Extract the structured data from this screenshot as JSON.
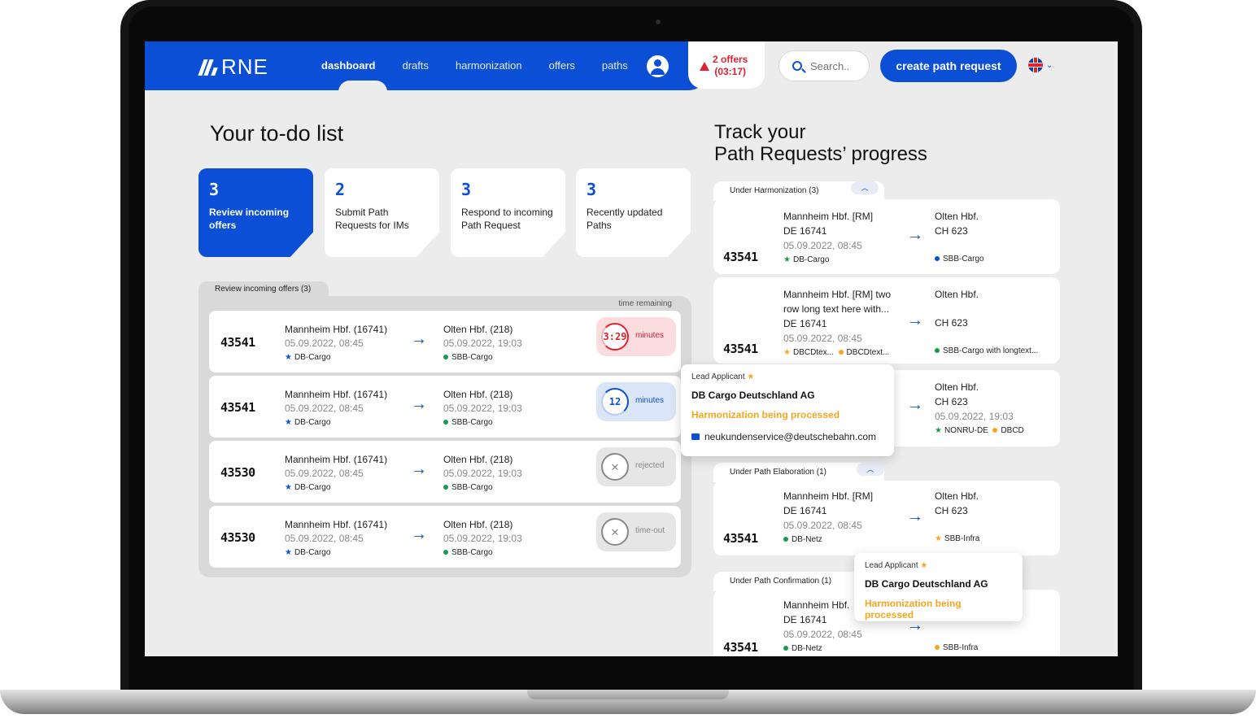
{
  "nav": {
    "logo": "RNE",
    "links": [
      "dashboard",
      "drafts",
      "harmonization",
      "offers",
      "paths"
    ],
    "offers_alert": [
      "2 offers",
      "(03:17)"
    ],
    "search_placeholder": "Search..",
    "create_button": "create path request"
  },
  "todo": {
    "title": "Your to-do list",
    "cards": [
      {
        "count": "3",
        "label": "Review incoming offers"
      },
      {
        "count": "2",
        "label": "Submit Path Requests for IMs"
      },
      {
        "count": "3",
        "label": "Respond to incoming Path Request"
      },
      {
        "count": "3",
        "label": "Recently updated Paths"
      }
    ]
  },
  "offers": {
    "tab_label": "Review incoming offers (3)",
    "time_remaining_label": "time remaining",
    "rows": [
      {
        "id": "43541",
        "from": "Mannheim Hbf. (16741)",
        "from_time": "05.09.2022, 08:45",
        "from_op": "DB-Cargo",
        "to": "Olten Hbf. (218)",
        "to_time": "05.09.2022, 19:03",
        "to_op": "SBB-Cargo",
        "status_value": "3:29",
        "status_label": "minutes"
      },
      {
        "id": "43541",
        "from": "Mannheim Hbf. (16741)",
        "from_time": "05.09.2022, 08:45",
        "from_op": "DB-Cargo",
        "to": "Olten Hbf. (218)",
        "to_time": "05.09.2022, 19:03",
        "to_op": "SBB-Cargo",
        "status_value": "12",
        "status_label": "minutes"
      },
      {
        "id": "43530",
        "from": "Mannheim Hbf. (16741)",
        "from_time": "05.09.2022, 08:45",
        "from_op": "DB-Cargo",
        "to": "Olten Hbf. (218)",
        "to_time": "05.09.2022, 19:03",
        "to_op": "SBB-Cargo",
        "status_value": "✕",
        "status_label": "rejected"
      },
      {
        "id": "43530",
        "from": "Mannheim Hbf. (16741)",
        "from_time": "05.09.2022, 08:45",
        "from_op": "DB-Cargo",
        "to": "Olten Hbf. (218)",
        "to_time": "05.09.2022, 19:03",
        "to_op": "SBB-Cargo",
        "status_value": "✕",
        "status_label": "time-out"
      }
    ]
  },
  "track": {
    "title_line1": "Track your",
    "title_line2": "Path Requests’ progress",
    "groups": {
      "harmonization": "Under Harmonization (3)",
      "elaboration": "Under Path Elaboration (1)",
      "confirmation": "Under Path Confirmation (1)"
    },
    "cards": [
      {
        "id": "43541",
        "from": "Mannheim Hbf. [RM]",
        "from_code": "DE 16741",
        "from_time": "05.09.2022, 08:45",
        "from_op": "DB-Cargo",
        "to": "Olten Hbf.",
        "to_code": "CH 623",
        "to_op": "SBB-Cargo"
      },
      {
        "id": "43541",
        "from_l1": "Mannheim Hbf. [RM] two",
        "from_l2": "row long text here with...",
        "from_code": "DE 16741",
        "from_time": "05.09.2022, 08:45",
        "from_op1": "DBCDtex...",
        "from_op2": "DBCDtext...",
        "to": "Olten Hbf.",
        "to_code": "CH 623",
        "to_op": "SBB-Cargo with longtext..."
      },
      {
        "to": "Olten Hbf.",
        "to_code": "CH 623",
        "to_time": "05.09.2022, 19:03",
        "to_op1": "NONRU-DE",
        "to_op2": "DBCD"
      },
      {
        "id": "43541",
        "from": "Mannheim Hbf. [RM]",
        "from_code": "DE 16741",
        "from_time": "05.09.2022, 08:45",
        "from_op": "DB-Netz",
        "to": "Olten Hbf.",
        "to_code": "CH 623",
        "to_op": "SBB-Infra"
      },
      {
        "id": "43541",
        "from": "Mannheim Hbf.",
        "from_code": "DE 16741",
        "from_time": "05.09.2022, 08:45",
        "from_op": "DB-Netz",
        "to_op": "SBB-Infra"
      }
    ]
  },
  "tooltips": {
    "lead_applicant": "Lead Applicant",
    "company": "DB Cargo Deutschland AG",
    "status": "Harmonization being processed",
    "email": "neukundenservice@deutschebahn.com"
  },
  "colors": {
    "brand": "#0b4fd6",
    "alert": "#e0222f",
    "accent": "#f6a623",
    "success": "#1a9a4b"
  }
}
